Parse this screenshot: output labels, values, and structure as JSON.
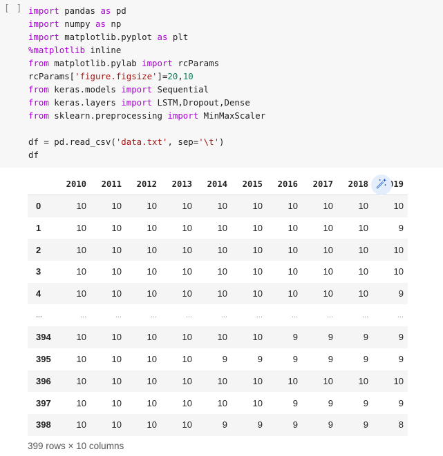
{
  "code_cell": {
    "run_indicator": "[ ]",
    "lines": [
      [
        {
          "t": "kw",
          "v": "import"
        },
        {
          "t": "txt",
          "v": " pandas "
        },
        {
          "t": "kw",
          "v": "as"
        },
        {
          "t": "txt",
          "v": " pd"
        }
      ],
      [
        {
          "t": "kw",
          "v": "import"
        },
        {
          "t": "txt",
          "v": " numpy "
        },
        {
          "t": "kw",
          "v": "as"
        },
        {
          "t": "txt",
          "v": " np"
        }
      ],
      [
        {
          "t": "kw",
          "v": "import"
        },
        {
          "t": "txt",
          "v": " matplotlib.pyplot "
        },
        {
          "t": "kw",
          "v": "as"
        },
        {
          "t": "txt",
          "v": " plt"
        }
      ],
      [
        {
          "t": "kw",
          "v": "%matplotlib"
        },
        {
          "t": "txt",
          "v": " inline"
        }
      ],
      [
        {
          "t": "kw",
          "v": "from"
        },
        {
          "t": "txt",
          "v": " matplotlib.pylab "
        },
        {
          "t": "kw",
          "v": "import"
        },
        {
          "t": "txt",
          "v": " rcParams"
        }
      ],
      [
        {
          "t": "txt",
          "v": "rcParams["
        },
        {
          "t": "str",
          "v": "'figure.figsize'"
        },
        {
          "t": "txt",
          "v": "]="
        },
        {
          "t": "num",
          "v": "20"
        },
        {
          "t": "txt",
          "v": ","
        },
        {
          "t": "num",
          "v": "10"
        }
      ],
      [
        {
          "t": "kw",
          "v": "from"
        },
        {
          "t": "txt",
          "v": " keras.models "
        },
        {
          "t": "kw",
          "v": "import"
        },
        {
          "t": "txt",
          "v": " Sequential"
        }
      ],
      [
        {
          "t": "kw",
          "v": "from"
        },
        {
          "t": "txt",
          "v": " keras.layers "
        },
        {
          "t": "kw",
          "v": "import"
        },
        {
          "t": "txt",
          "v": " LSTM,Dropout,Dense"
        }
      ],
      [
        {
          "t": "kw",
          "v": "from"
        },
        {
          "t": "txt",
          "v": " sklearn.preprocessing "
        },
        {
          "t": "kw",
          "v": "import"
        },
        {
          "t": "txt",
          "v": " MinMaxScaler"
        }
      ],
      [],
      [
        {
          "t": "txt",
          "v": "df = pd.read_csv("
        },
        {
          "t": "str",
          "v": "'data.txt'"
        },
        {
          "t": "txt",
          "v": ", sep="
        },
        {
          "t": "str",
          "v": "'\\t'"
        },
        {
          "t": "txt",
          "v": ")"
        }
      ],
      [
        {
          "t": "txt",
          "v": "df"
        }
      ]
    ]
  },
  "dataframe": {
    "columns": [
      "2010",
      "2011",
      "2012",
      "2013",
      "2014",
      "2015",
      "2016",
      "2017",
      "2018",
      "2019"
    ],
    "rows": [
      {
        "index": "0",
        "values": [
          "10",
          "10",
          "10",
          "10",
          "10",
          "10",
          "10",
          "10",
          "10",
          "10"
        ]
      },
      {
        "index": "1",
        "values": [
          "10",
          "10",
          "10",
          "10",
          "10",
          "10",
          "10",
          "10",
          "10",
          "9"
        ]
      },
      {
        "index": "2",
        "values": [
          "10",
          "10",
          "10",
          "10",
          "10",
          "10",
          "10",
          "10",
          "10",
          "10"
        ]
      },
      {
        "index": "3",
        "values": [
          "10",
          "10",
          "10",
          "10",
          "10",
          "10",
          "10",
          "10",
          "10",
          "10"
        ]
      },
      {
        "index": "4",
        "values": [
          "10",
          "10",
          "10",
          "10",
          "10",
          "10",
          "10",
          "10",
          "10",
          "9"
        ]
      },
      {
        "index": "...",
        "values": [
          "...",
          "...",
          "...",
          "...",
          "...",
          "...",
          "...",
          "...",
          "...",
          "..."
        ],
        "ellipsis": true
      },
      {
        "index": "394",
        "values": [
          "10",
          "10",
          "10",
          "10",
          "10",
          "10",
          "9",
          "9",
          "9",
          "9"
        ]
      },
      {
        "index": "395",
        "values": [
          "10",
          "10",
          "10",
          "10",
          "9",
          "9",
          "9",
          "9",
          "9",
          "9"
        ]
      },
      {
        "index": "396",
        "values": [
          "10",
          "10",
          "10",
          "10",
          "10",
          "10",
          "10",
          "10",
          "10",
          "10"
        ]
      },
      {
        "index": "397",
        "values": [
          "10",
          "10",
          "10",
          "10",
          "10",
          "10",
          "9",
          "9",
          "9",
          "9"
        ]
      },
      {
        "index": "398",
        "values": [
          "10",
          "10",
          "10",
          "10",
          "9",
          "9",
          "9",
          "9",
          "9",
          "8"
        ]
      }
    ],
    "shape_text": "399 rows × 10 columns"
  },
  "magic_button": {
    "icon": "magic-wand-icon",
    "color": "#1a56c4",
    "background": "#e3edfb"
  }
}
